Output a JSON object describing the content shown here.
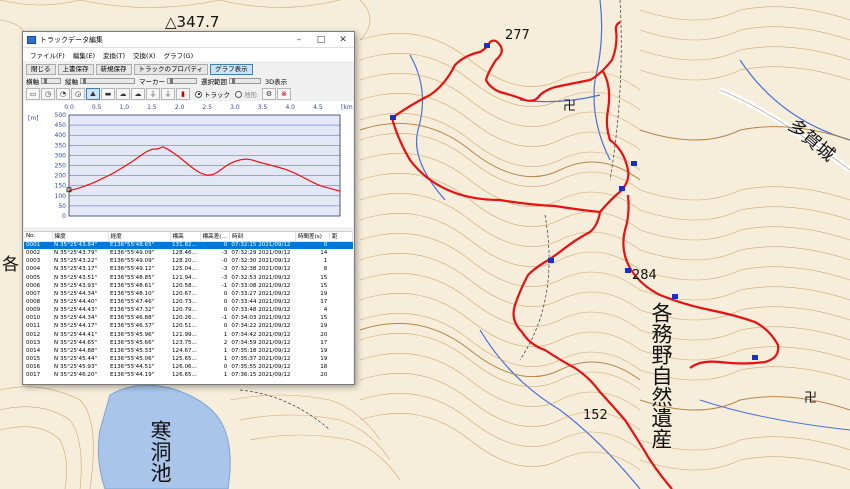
{
  "map": {
    "labels": {
      "summit": "△347.7",
      "peak_277": "277",
      "peak_284": "284",
      "elev_152": "152",
      "region_kakamigahara": "各務野自然遺産",
      "pond": "寒洞池",
      "area_edge": "多賀城",
      "edge_text": "各"
    },
    "route_color": "#e81010",
    "waypoint_color": "#1a2fc8"
  },
  "window": {
    "title": "トラックデータ編集",
    "controls": [
      "–",
      "□",
      "✕"
    ],
    "menu": [
      "ファイル(F)",
      "編集(E)",
      "変換(T)",
      "交換(X)",
      "グラフ(G)"
    ],
    "buttons": [
      "閉じる",
      "上書保存",
      "新規保存",
      "トラックのプロパティ",
      "グラフ表示"
    ],
    "toolbar2": {
      "horizontal": "横軸",
      "vertical": "縦軸",
      "marker": "マーカー",
      "selection": "選択範囲",
      "display3d": "3D表示"
    },
    "radio": {
      "track": "トラック",
      "terrain": "地形"
    },
    "icons": [
      "line-icon",
      "clock-icon",
      "stopwatch-icon",
      "clock-alt-icon",
      "mountain-icon",
      "flat-icon",
      "cloud-icon",
      "cloud2-icon",
      "plug-icon",
      "plug2-icon",
      "thermometer-icon"
    ]
  },
  "chart_data": {
    "type": "line",
    "xlabel": "[km]",
    "ylabel": "[m]",
    "x_ticks": [
      "0.0",
      "0.5",
      "1.0",
      "1.5",
      "2.0",
      "2.5",
      "3.0",
      "3.5",
      "4.0",
      "4.5"
    ],
    "y_ticks": [
      "500",
      "450",
      "400",
      "350",
      "300",
      "250",
      "200",
      "150",
      "100",
      "50",
      "0"
    ],
    "xlim": [
      0,
      4.9
    ],
    "ylim": [
      0,
      500
    ],
    "series": [
      {
        "x": [
          0.0,
          0.1,
          0.2,
          0.3,
          0.4,
          0.5,
          0.6,
          0.7,
          0.8,
          0.9,
          1.0,
          1.1,
          1.2,
          1.3,
          1.4,
          1.5,
          1.6,
          1.7,
          1.8,
          1.9,
          2.0,
          2.1,
          2.2,
          2.3,
          2.4,
          2.5,
          2.6,
          2.7,
          2.8,
          2.9,
          3.0,
          3.1,
          3.2,
          3.3,
          3.4,
          3.5,
          3.6,
          3.7,
          3.8,
          3.9,
          4.0,
          4.1,
          4.2,
          4.3,
          4.4,
          4.5,
          4.6,
          4.7,
          4.8,
          4.9
        ],
        "y": [
          125,
          132,
          140,
          150,
          160,
          172,
          185,
          198,
          212,
          228,
          245,
          262,
          280,
          300,
          318,
          330,
          332,
          342,
          328,
          310,
          290,
          268,
          245,
          225,
          210,
          202,
          205,
          220,
          240,
          258,
          270,
          278,
          282,
          278,
          270,
          262,
          255,
          248,
          240,
          232,
          222,
          210,
          196,
          182,
          168,
          155,
          145,
          138,
          130,
          124
        ]
      }
    ]
  },
  "table": {
    "headers": [
      "No.",
      "緯度",
      "経度",
      "標高",
      "標高差(...",
      "時刻",
      "時間差(s)",
      "距"
    ],
    "rows": [
      [
        "0001",
        "N 35°25'43.84\"",
        "E136°55'48.65\"",
        "131.82...",
        "0",
        "07:32:15 2021/09/12",
        "0"
      ],
      [
        "0002",
        "N 35°25'43.79\"",
        "E136°55'49.09\"",
        "128.46...",
        "-3",
        "07:32:29 2021/09/12",
        "14"
      ],
      [
        "0003",
        "N 35°25'43.22\"",
        "E136°55'49.09\"",
        "128.20...",
        "-0",
        "07:32:30 2021/09/12",
        "1"
      ],
      [
        "0004",
        "N 35°25'43.17\"",
        "E136°55'49.12\"",
        "125.04...",
        "-3",
        "07:32:38 2021/09/12",
        "8"
      ],
      [
        "0005",
        "N 35°25'43.51\"",
        "E136°55'48.85\"",
        "121.94...",
        "-3",
        "07:32:53 2021/09/12",
        "15"
      ],
      [
        "0006",
        "N 35°25'43.93\"",
        "E136°55'48.61\"",
        "120.58...",
        "-1",
        "07:33:08 2021/09/12",
        "15"
      ],
      [
        "0007",
        "N 35°25'44.34\"",
        "E136°55'48.10\"",
        "120.67...",
        "0",
        "07:33:27 2021/09/12",
        "19"
      ],
      [
        "0008",
        "N 35°25'44.40\"",
        "E136°55'47.46\"",
        "120.73...",
        "0",
        "07:33:44 2021/09/12",
        "17"
      ],
      [
        "0009",
        "N 35°25'44.43\"",
        "E136°55'47.32\"",
        "120.79...",
        "0",
        "07:33:48 2021/09/12",
        "4"
      ],
      [
        "0010",
        "N 35°25'44.34\"",
        "E136°55'46.88\"",
        "120.26...",
        "-1",
        "07:34:03 2021/09/12",
        "15"
      ],
      [
        "0011",
        "N 35°25'44.17\"",
        "E136°55'46.37\"",
        "120.51...",
        "0",
        "07:34:22 2021/09/12",
        "19"
      ],
      [
        "0012",
        "N 35°25'44.41\"",
        "E136°55'45.96\"",
        "121.99...",
        "1",
        "07:34:42 2021/09/12",
        "20"
      ],
      [
        "0013",
        "N 35°25'44.65\"",
        "E136°55'45.66\"",
        "123.75...",
        "2",
        "07:34:59 2021/09/12",
        "17"
      ],
      [
        "0014",
        "N 35°25'44.88\"",
        "E136°55'45.33\"",
        "124.67...",
        "1",
        "07:35:18 2021/09/12",
        "19"
      ],
      [
        "0015",
        "N 35°25'45.44\"",
        "E136°55'45.06\"",
        "125.65...",
        "1",
        "07:35:37 2021/09/12",
        "19"
      ],
      [
        "0016",
        "N 35°25'45.93\"",
        "E136°55'44.51\"",
        "126.06...",
        "0",
        "07:35:55 2021/09/12",
        "18"
      ],
      [
        "0017",
        "N 35°25'46.20\"",
        "E136°55'44.19\"",
        "126.65...",
        "1",
        "07:36:15 2021/09/12",
        "20"
      ]
    ]
  }
}
